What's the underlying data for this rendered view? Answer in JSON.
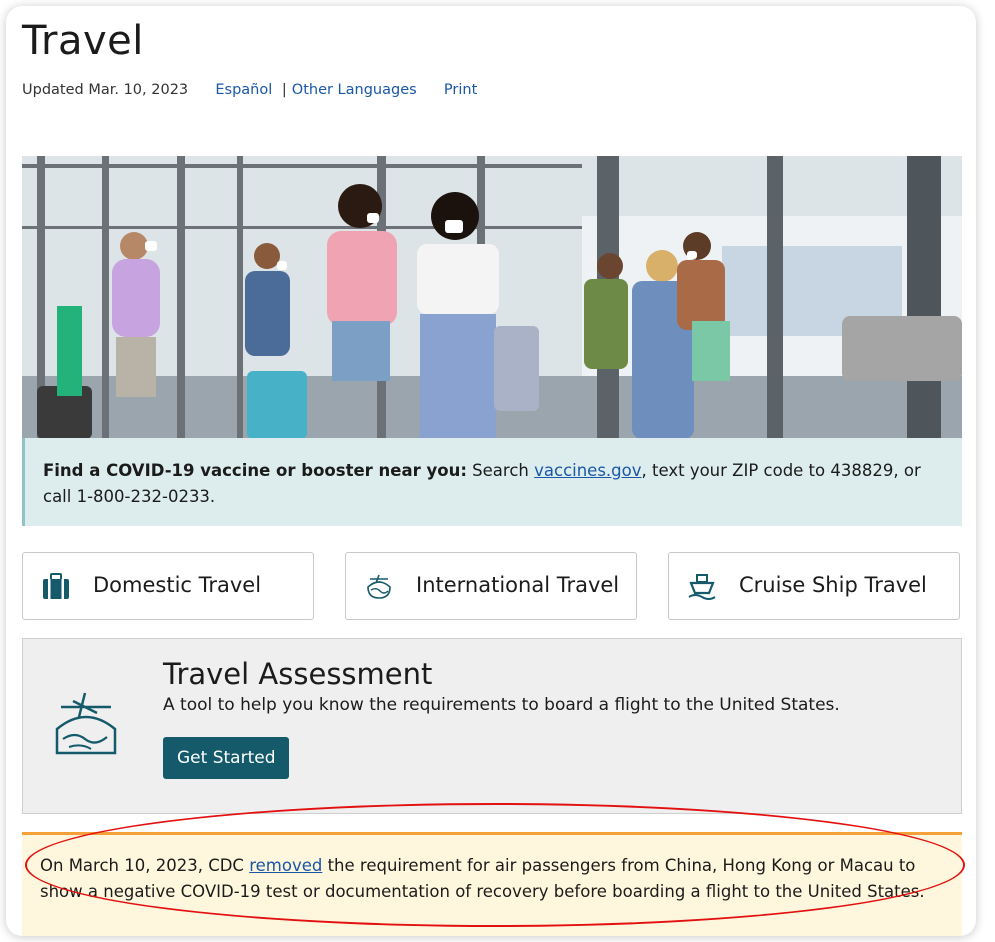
{
  "page": {
    "title": "Travel",
    "updated": "Updated Mar. 10, 2023",
    "lang_es": "Español",
    "lang_sep": "|",
    "lang_other": "Other Languages",
    "print": "Print"
  },
  "banner": {
    "bold_lead": "Find a COVID-19 vaccine or booster near you:",
    "text_before": " Search ",
    "link": "vaccines.gov",
    "text_after": ", text your ZIP code to 438829, or call 1-800-232-0233."
  },
  "tiles": [
    {
      "label": "Domestic Travel",
      "icon": "suitcase-icon"
    },
    {
      "label": "International Travel",
      "icon": "plane-globe-icon"
    },
    {
      "label": "Cruise Ship Travel",
      "icon": "ship-icon"
    }
  ],
  "assessment": {
    "title": "Travel Assessment",
    "description": "A tool to help you know the requirements to board a flight to the United States.",
    "button": "Get Started"
  },
  "alert": {
    "text_before": "On March 10, 2023, CDC ",
    "link": "removed",
    "text_after": " the requirement for air passengers from China, Hong Kong or Macau to show a negative COVID-19 test or documentation of recovery before boarding a flight to the United States."
  },
  "colors": {
    "accent_link": "#1a57a6",
    "button_bg": "#155a6b",
    "banner_bg": "#ddeded",
    "alert_bg": "#fff7dd",
    "alert_border": "#f5a13a",
    "annotation": "#e31010"
  }
}
